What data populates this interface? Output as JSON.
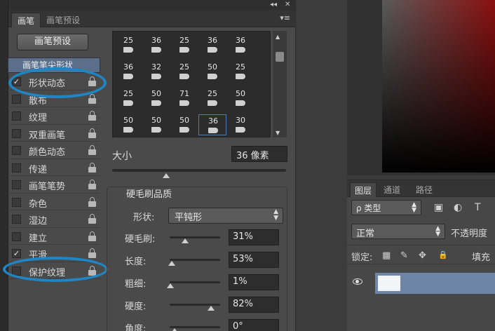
{
  "brush_panel": {
    "topbar": {
      "collapse_label": "◂◂",
      "close_label": "✕"
    },
    "tabs": [
      {
        "label": "画笔"
      },
      {
        "label": "画笔预设"
      }
    ],
    "menu_label": "▾≡",
    "preset_button_label": "画笔预设",
    "option_header": "画笔笔尖形状",
    "options": [
      {
        "label": "形状动态",
        "checked": true
      },
      {
        "label": "散布",
        "checked": false
      },
      {
        "label": "纹理",
        "checked": false
      },
      {
        "label": "双重画笔",
        "checked": false
      },
      {
        "label": "颜色动态",
        "checked": false
      },
      {
        "label": "传递",
        "checked": false
      },
      {
        "label": "画笔笔势",
        "checked": false
      },
      {
        "label": "杂色",
        "checked": false
      },
      {
        "label": "湿边",
        "checked": false
      },
      {
        "label": "建立",
        "checked": false
      },
      {
        "label": "平滑",
        "checked": true
      },
      {
        "label": "保护纹理",
        "checked": false
      }
    ],
    "tip_rows": [
      [
        "25",
        "36",
        "25",
        "36",
        "36"
      ],
      [
        "36",
        "32",
        "25",
        "50",
        "25"
      ],
      [
        "25",
        "50",
        "71",
        "25",
        "50"
      ],
      [
        "50",
        "50",
        "50",
        "36",
        "30"
      ]
    ],
    "selected_tip": {
      "row": 3,
      "col": 3
    },
    "size": {
      "label": "大小",
      "value": "36 像素",
      "slider_fraction": 0.31
    },
    "bristle": {
      "title": "硬毛刷品质",
      "shape_label": "形状:",
      "shape_value": "平钝形",
      "params": [
        {
          "label": "硬毛刷:",
          "value": "31%",
          "fraction": 0.31
        },
        {
          "label": "长度:",
          "value": "53%",
          "fraction": 0.04
        },
        {
          "label": "粗细:",
          "value": "1%",
          "fraction": 0.01
        },
        {
          "label": "硬度:",
          "value": "82%",
          "fraction": 0.82
        },
        {
          "label": "角度:",
          "value": "0°",
          "fraction": 0.1
        }
      ]
    }
  },
  "layers_panel": {
    "tabs": [
      {
        "label": "图层"
      },
      {
        "label": "通道"
      },
      {
        "label": "路径"
      }
    ],
    "filter_label": "ρ 类型",
    "filter_icons": [
      "▣",
      "◐",
      "T"
    ],
    "blend_mode": "正常",
    "opacity_label": "不透明度",
    "lock_label": "锁定:",
    "lock_icons": [
      "▦",
      "✎",
      "✥",
      "🔒"
    ],
    "fill_label": "填充"
  },
  "colors": {
    "highlight": "#1e86c4",
    "panel_bg": "#4a4a4a",
    "layer_selected": "#6d85a6",
    "color_field_red": "#8c1010"
  }
}
